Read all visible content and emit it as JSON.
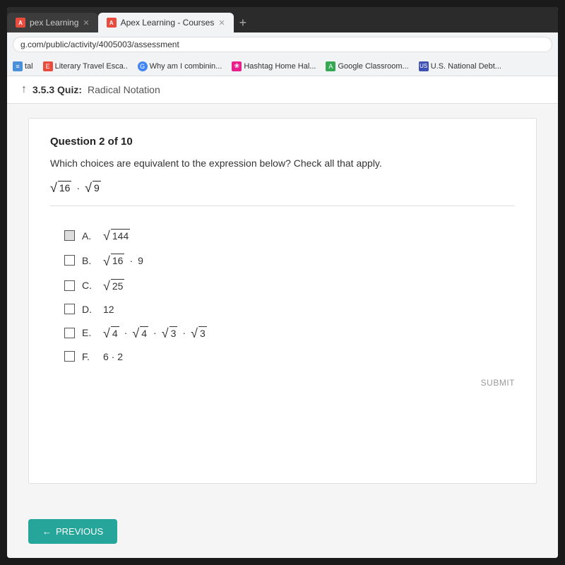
{
  "browser": {
    "tabs": [
      {
        "label": "pex Learning",
        "active": false,
        "favicon_color": "#e84c3d",
        "favicon_letter": "A"
      },
      {
        "label": "Apex Learning - Courses",
        "active": true,
        "favicon_color": "#e84c3d",
        "favicon_letter": "A"
      }
    ],
    "address": "g.com/public/activity/4005003/assessment",
    "bookmarks": [
      {
        "label": "tal",
        "icon": "≡",
        "icon_color": "#4a90d9"
      },
      {
        "label": "Literary Travel Esca...",
        "icon": "E",
        "icon_color": "#e84c3d"
      },
      {
        "label": "Why am I combinin...",
        "icon": "G",
        "icon_color": "#4285f4"
      },
      {
        "label": "Hashtag Home Hal...",
        "icon": "❀",
        "icon_color": "#e91e8c"
      },
      {
        "label": "Google Classroom...",
        "icon": "A",
        "icon_color": "#34a853"
      },
      {
        "label": "U.S. National Debt...",
        "icon": "US",
        "icon_color": "#3f51b5"
      }
    ]
  },
  "quiz": {
    "breadcrumb_icon": "↑",
    "breadcrumb_label": "3.5.3 Quiz:",
    "breadcrumb_title": "Radical Notation",
    "question_header": "Question 2 of 10",
    "question_text": "Which choices are equivalent to the expression below? Check all that apply.",
    "expression": "√16 · √9",
    "choices": [
      {
        "letter": "A.",
        "expression": "√144",
        "checked": true
      },
      {
        "letter": "B.",
        "expression": "√16 · 9"
      },
      {
        "letter": "C.",
        "expression": "√25"
      },
      {
        "letter": "D.",
        "expression": "12"
      },
      {
        "letter": "E.",
        "expression": "√4 · √4 · √3 · √3"
      },
      {
        "letter": "F.",
        "expression": "6 · 2"
      }
    ],
    "submit_label": "SUBMIT",
    "previous_label": "← PREVIOUS"
  }
}
